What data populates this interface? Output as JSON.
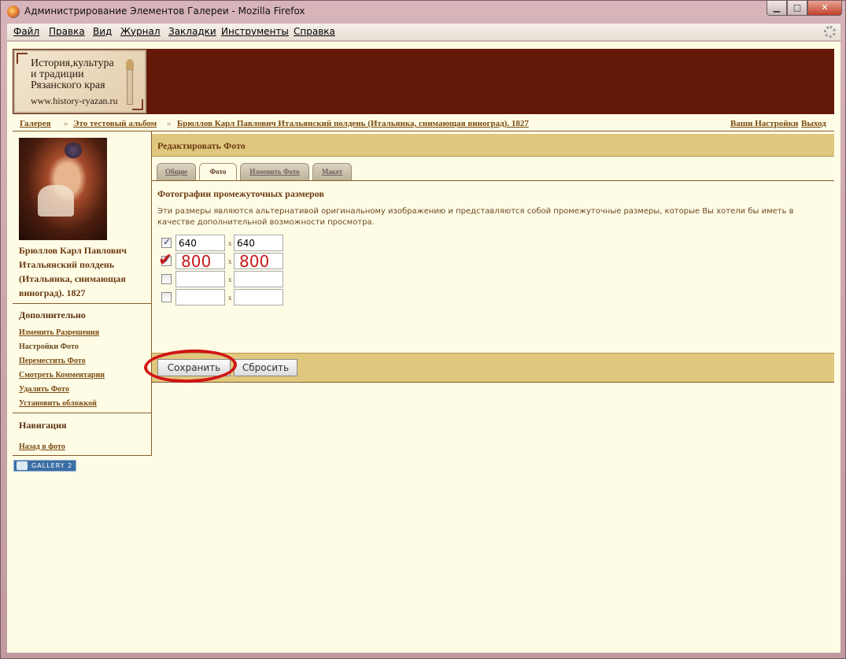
{
  "window": {
    "title": "Администрирование Элементов Галереи - Mozilla Firefox",
    "minimize": "▁",
    "maximize": "□",
    "close": "✕"
  },
  "menu": [
    "Файл",
    "Правка",
    "Вид",
    "Журнал",
    "Закладки",
    "Инструменты",
    "Справка"
  ],
  "logo": {
    "line1": "История,культура",
    "line2": "и традиции",
    "line3": "Рязанского края",
    "url": "www.history-ryazan.ru"
  },
  "breadcrumb": {
    "gallery": "Галерея",
    "album": "Это тестовый альбом",
    "photo": "Брюллов Карл Павлович Итальянский полдень (Итальянка, снимающая виноград). 1827",
    "separator": "»",
    "settings": "Ваши Настройки",
    "logout": "Выход"
  },
  "sidebar": {
    "photo_title": "Брюллов Карл Павлович Итальянский полдень (Итальянка, снимающая виноград). 1827",
    "extra_heading": "Дополнительно",
    "extra_links": [
      "Изменить Разрешения",
      "Настройки Фото",
      "Переместить Фото",
      "Смотреть Комментарии",
      "Удалить Фото",
      "Установить обложкой"
    ],
    "nav_heading": "Навигация",
    "back_link": "Назад в фото",
    "badge": "GALLERY 2"
  },
  "main": {
    "heading": "Редактировать Фото",
    "tabs": [
      "Общие",
      "Фото",
      "Изменить Фото",
      "Макет"
    ],
    "active_tab": "Фото",
    "section_title": "Фотографии промежуточных размеров",
    "description": "Эти размеры являются альтернативой оригинальному изображению и представляются собой промежуточные размеры, которые Вы хотели бы иметь в качестве дополнительной возможности просмотра.",
    "sizes": [
      {
        "checked": true,
        "width": "640",
        "height": "640"
      },
      {
        "checked": true,
        "width": "800",
        "height": "800"
      },
      {
        "checked": false,
        "width": "",
        "height": ""
      },
      {
        "checked": false,
        "width": "",
        "height": ""
      }
    ],
    "x_sep": "x",
    "save": "Сохранить",
    "reset": "Сбросить"
  },
  "colors": {
    "banner": "#631808",
    "header_bar": "#e0c77e",
    "page_bg": "#fffce6",
    "annotation_red": "#d11414"
  }
}
